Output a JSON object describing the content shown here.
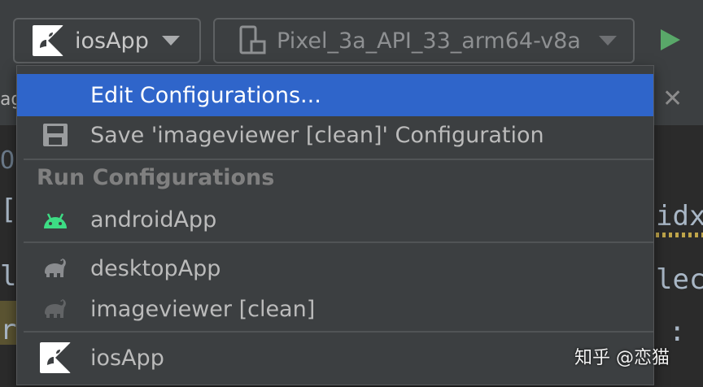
{
  "toolbar": {
    "config_selector": {
      "label": "iosApp",
      "icon": "kotlin-ios-icon"
    },
    "device_selector": {
      "label": "Pixel_3a_API_33_arm64-v8a",
      "icon": "phone-device-icon"
    },
    "run": {
      "icon": "run-icon",
      "color": "#59a869"
    }
  },
  "editor": {
    "tab_fragment": "ag",
    "code_fragments": [
      "O|",
      "[i",
      "le",
      "ru",
      "idx",
      "lec",
      ": i"
    ]
  },
  "popup_menu": {
    "selected_color": "#2f65ca",
    "items_top": [
      {
        "label": "Edit Configurations...",
        "icon": "",
        "selected": true
      },
      {
        "label": "Save 'imageviewer [clean]' Configuration",
        "icon": "save-icon",
        "selected": false
      }
    ],
    "section_header": "Run Configurations",
    "configurations": [
      {
        "label": "androidApp",
        "icon": "android-icon"
      },
      {
        "label": "desktopApp",
        "icon": "gradle-elephant-icon"
      },
      {
        "label": "imageviewer [clean]",
        "icon": "gradle-elephant-icon"
      },
      {
        "label": "iosApp",
        "icon": "kotlin-ios-icon"
      }
    ]
  },
  "watermark": "知乎 @恋猫"
}
